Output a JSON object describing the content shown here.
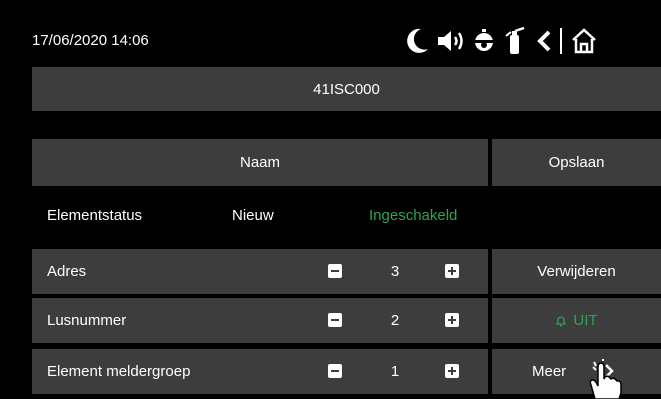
{
  "status_bar": {
    "datetime": "17/06/2020  14:06",
    "icons": [
      "moon-icon",
      "speaker-icon",
      "alarm-bell-icon",
      "extinguisher-icon",
      "back-icon",
      "home-icon"
    ]
  },
  "title": "41ISC000",
  "header": {
    "name_label": "Naam",
    "save_label": "Opslaan"
  },
  "element_status": {
    "label": "Elementstatus",
    "state": "Nieuw",
    "enabled": "Ingeschakeld"
  },
  "params": [
    {
      "label": "Adres",
      "value": "3",
      "action": "Verwijderen"
    },
    {
      "label": "Lusnummer",
      "value": "2",
      "action": "UIT"
    },
    {
      "label": "Element meldergroep",
      "value": "1",
      "action": "Meer"
    }
  ],
  "colors": {
    "background": "#000000",
    "panel": "#3d3d3d",
    "accent_green": "#2ea44f"
  }
}
